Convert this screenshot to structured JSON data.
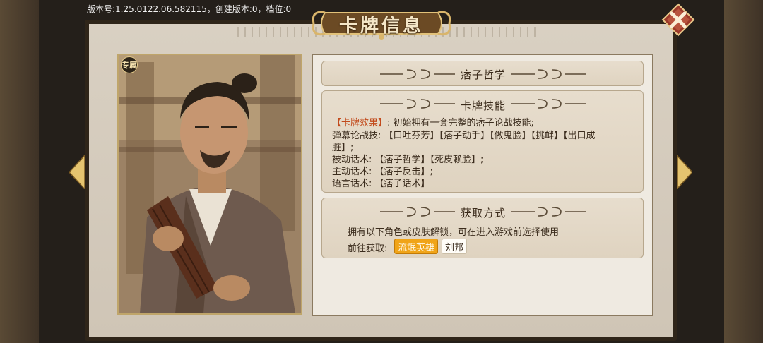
{
  "version_line": "版本号:1.25.0122.06.582115，创建版本:0，档位:0",
  "title": "卡牌信息",
  "badge": "专属",
  "card_name": "痞子哲学",
  "skills_section": {
    "title": "卡牌技能",
    "effect_label": "【卡牌效果】",
    "effect_text": ": 初始拥有一套完整的痞子论战技能;",
    "line2": "弹幕论战技: 【口吐芬芳】【痞子动手】【做鬼脸】【挑衅】【出口成",
    "line3": "脏】;",
    "line4": "被动话术: 【痞子哲学】【死皮赖脸】;",
    "line5": "主动话术: 【痞子反击】;",
    "line6": "语言话术: 【痞子话术】"
  },
  "acquire_section": {
    "title": "获取方式",
    "desc": "拥有以下角色或皮肤解锁，可在进入游戏前选择使用",
    "goto_label": "前往获取:",
    "options": [
      "流氓英雄",
      "刘邦"
    ]
  },
  "colors": {
    "accent_orange": "#f0a418",
    "highlight_text": "#c24a1b",
    "panel_bg": "#efeae1"
  }
}
